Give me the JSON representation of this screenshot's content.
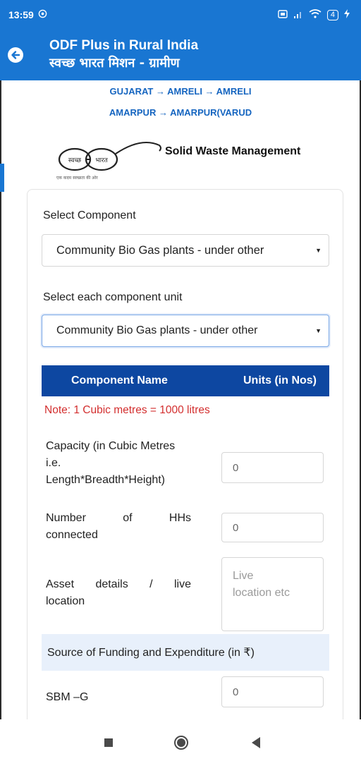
{
  "status_bar": {
    "time": "13:59",
    "battery": "4"
  },
  "app_bar": {
    "title": "ODF Plus in Rural India",
    "subtitle": "स्वच्छ भारत मिशन - ग्रामीण"
  },
  "breadcrumb": {
    "line1": "GUJARAT → AMRELI → AMRELI",
    "line2": "AMARPUR → AMARPUR(VARUD"
  },
  "logo": {
    "text_left": "स्वच्छ",
    "text_right": "भारत",
    "caption": "एक कदम स्वच्छता की ओर"
  },
  "section_title": "Solid Waste Management",
  "form": {
    "component_label": "Select Component",
    "component_value": "Community Bio Gas plants - under other",
    "unit_label": "Select each component unit",
    "unit_value": "Community Bio Gas plants - under other",
    "table_header": {
      "col1": "Component Name",
      "col2": "Units (in Nos)"
    },
    "note": "Note: 1 Cubic metres = 1000 litres",
    "capacity": {
      "label_line1": "Capacity (in Cubic Metres",
      "label_line2": "i.e.",
      "label_line3": "Length*Breadth*Height)",
      "value": "0"
    },
    "households": {
      "label_line1": "Number of HHs",
      "label_line2": "connected",
      "value": "0"
    },
    "asset": {
      "label_line1": "Asset details / live",
      "label_line2": "location",
      "placeholder_line1": "Live",
      "placeholder_line2": "location etc"
    },
    "funding_header": "Source of Funding and Expenditure (in ₹)",
    "sbm_label": "SBM –G",
    "sbm_value": "0"
  },
  "colors": {
    "primary": "#1976d2",
    "table_header": "#0d47a1",
    "breadcrumb": "#1565c0",
    "note": "#d32f2f",
    "funding_bg": "#e8f0fb"
  }
}
